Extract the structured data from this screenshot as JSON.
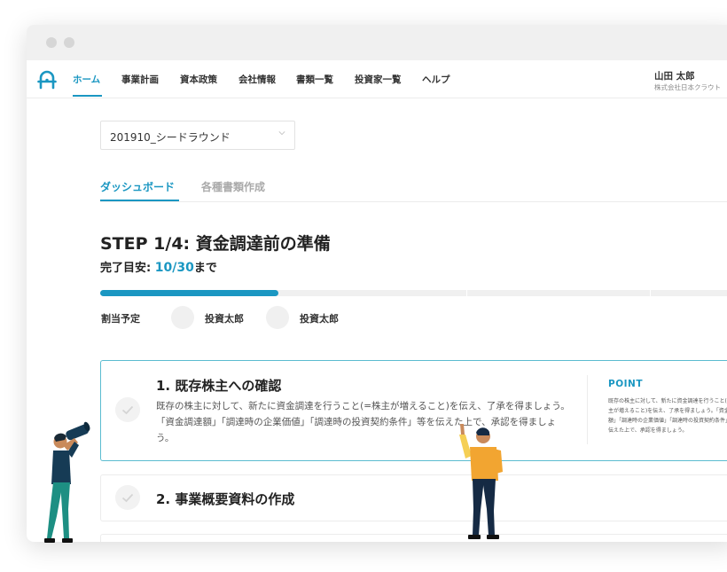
{
  "nav": {
    "items": [
      {
        "label": "ホーム",
        "active": true
      },
      {
        "label": "事業計画",
        "active": false
      },
      {
        "label": "資本政策",
        "active": false
      },
      {
        "label": "会社情報",
        "active": false
      },
      {
        "label": "書類一覧",
        "active": false
      },
      {
        "label": "投資家一覧",
        "active": false
      },
      {
        "label": "ヘルプ",
        "active": false
      }
    ],
    "user_name": "山田 太郎",
    "user_company": "株式会社日本クラウト"
  },
  "round_select": {
    "value": "201910_シードラウンド",
    "icon": "chevron-down-icon"
  },
  "tabs": [
    {
      "label": "ダッシュボード",
      "active": true
    },
    {
      "label": "各種書類作成",
      "active": false
    }
  ],
  "step": {
    "title": "STEP 1/4: 資金調達前の準備",
    "target_prefix": "完了目安: ",
    "target_date": "10/30",
    "target_suffix": "まで",
    "progress_fraction": 0.28
  },
  "assignment": {
    "label": "割当予定",
    "investors": [
      "投資太郎",
      "投資太郎"
    ]
  },
  "tasks": [
    {
      "title": "1. 既存株主への確認",
      "description": "既存の株主に対して、新たに資金調達を行うこと(=株主が増えること)を伝え、了承を得ましょう。「資金調達額」「調達時の企業価値」「調達時の投資契約条件」等を伝えた上で、承認を得ましょう。",
      "point_label": "POINT",
      "point_text": "既存の株主に対して、新たに資金調達を行うこと(=株主が増えること)を伝え、了承を得ましょう。「資金調達額」「調達時の企業価値」「調達時の投資契約条件」等を伝えた上で、承認を得ましょう。"
    },
    {
      "title": "2. 事業概要資料の作成"
    }
  ],
  "colors": {
    "accent": "#1b97c2",
    "card_border": "#5bbcd0"
  }
}
